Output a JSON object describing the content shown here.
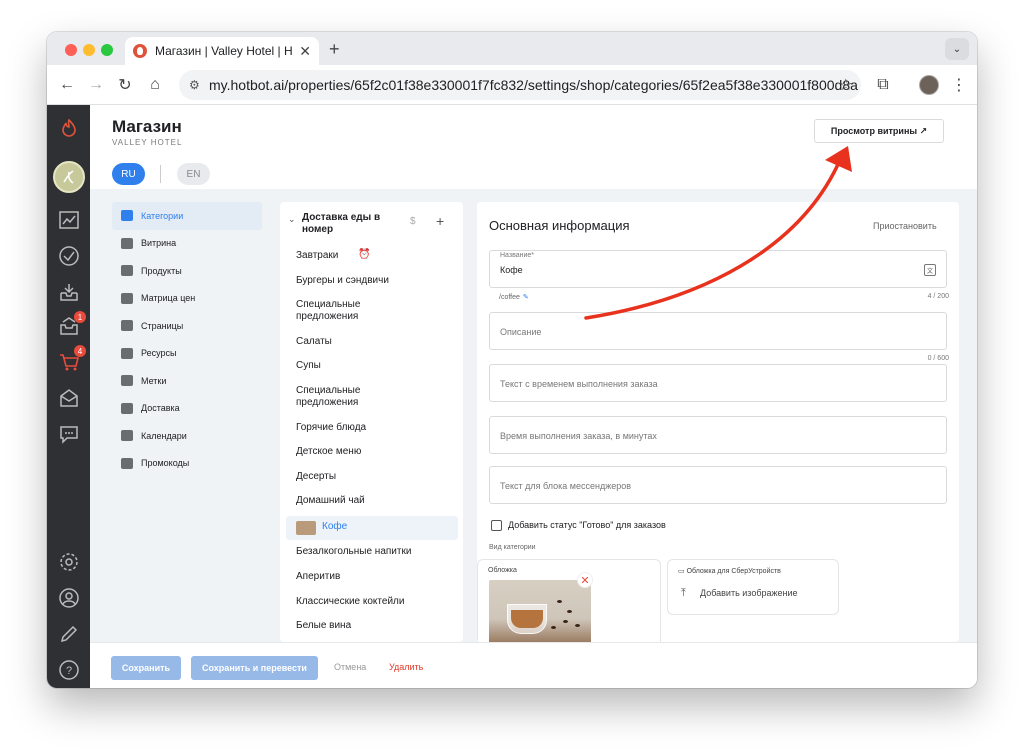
{
  "browser": {
    "tab_title": "Магазин | Valley Hotel | Hotbot",
    "url": "my.hotbot.ai/properties/65f2c01f38e330001f7fc832/settings/shop/categories/65f2ea5f38e330001f800d8a"
  },
  "rail": {
    "badges": [
      "1",
      "4"
    ]
  },
  "header": {
    "title": "Магазин",
    "subtitle": "VALLEY HOTEL",
    "preview_button": "Просмотр витрины ↗",
    "langs": [
      "RU",
      "EN"
    ]
  },
  "sidebar": {
    "items": [
      {
        "label": "Категории",
        "icon": "store-icon"
      },
      {
        "label": "Витрина",
        "icon": "tag-icon"
      },
      {
        "label": "Продукты",
        "icon": "grid-icon"
      },
      {
        "label": "Матрица цен",
        "icon": "calculator-icon"
      },
      {
        "label": "Страницы",
        "icon": "page-icon"
      },
      {
        "label": "Ресурсы",
        "icon": "resources-icon"
      },
      {
        "label": "Метки",
        "icon": "label-icon"
      },
      {
        "label": "Доставка",
        "icon": "truck-icon"
      },
      {
        "label": "Календари",
        "icon": "calendar-icon"
      },
      {
        "label": "Промокоды",
        "icon": "promo-icon"
      }
    ]
  },
  "categories": {
    "group_title": "Доставка еды в номер",
    "dollar": "$",
    "items": [
      "Завтраки",
      "Бургеры и сэндвичи",
      "Специальные предложения",
      "Салаты",
      "Супы",
      "Специальные предложения",
      "Горячие блюда",
      "Детское меню",
      "Десерты",
      "Домашний чай",
      "Кофе",
      "Безалкогольные напитки",
      "Аперитив",
      "Классические коктейли",
      "Белые вина"
    ]
  },
  "form": {
    "title": "Основная информация",
    "pause": "Приостановить",
    "name_label": "Название*",
    "name_value": "Кофе",
    "slug": "/coffee",
    "name_counter": "4 / 200",
    "description_placeholder": "Описание",
    "description_counter": "0 / 600",
    "order_time_text_placeholder": "Текст с временем выполнения заказа",
    "order_time_minutes_placeholder": "Время выполнения заказа, в минутах",
    "messengers_text_placeholder": "Текст для блока мессенджеров",
    "ready_status_label": "Добавить статус \"Готово\" для заказов",
    "view_label": "Вид категории",
    "cover_title": "Обложка",
    "sber_title": "Обложка для СберУстройств",
    "add_image": "Добавить изображение"
  },
  "footer": {
    "save": "Сохранить",
    "save_translate": "Сохранить и перевести",
    "cancel": "Отмена",
    "delete": "Удалить"
  },
  "colors": {
    "accent": "#2f80ed",
    "annotation_arrow": "#e8321e",
    "danger": "#e03a2a"
  }
}
